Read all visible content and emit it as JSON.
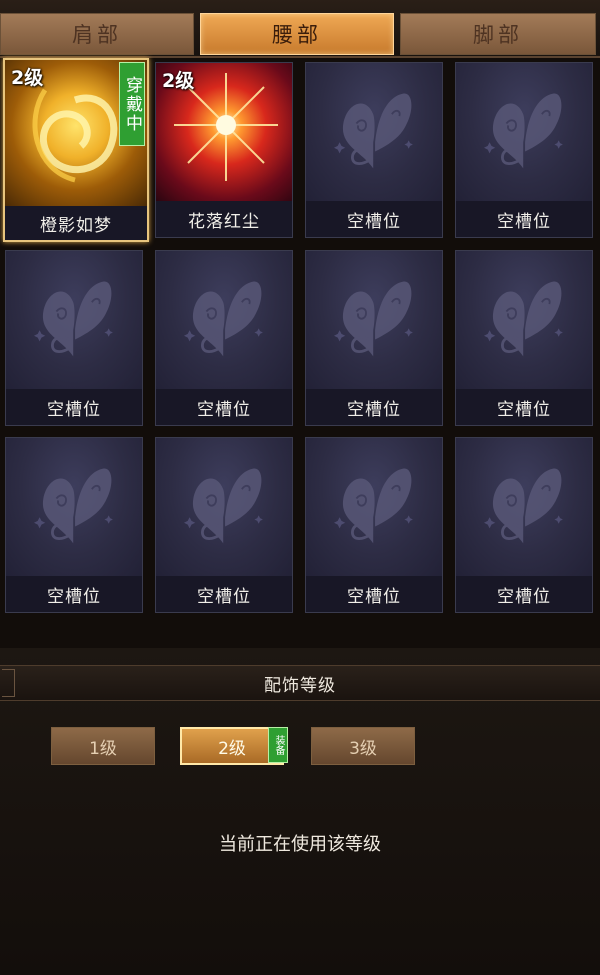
{
  "tabs": [
    {
      "label": "肩部",
      "active": false
    },
    {
      "label": "腰部",
      "active": true
    },
    {
      "label": "脚部",
      "active": false
    }
  ],
  "slots": [
    {
      "level": "2级",
      "name": "橙影如梦",
      "wearing": "穿戴中",
      "icon": "orange-swirl-icon"
    },
    {
      "level": "2级",
      "name": "花落红尘",
      "icon": "red-starburst-icon"
    },
    {
      "name": "空槽位",
      "icon": "butterfly-icon"
    },
    {
      "name": "空槽位",
      "icon": "butterfly-icon"
    },
    {
      "name": "空槽位",
      "icon": "butterfly-icon"
    },
    {
      "name": "空槽位",
      "icon": "butterfly-icon"
    },
    {
      "name": "空槽位",
      "icon": "butterfly-icon"
    },
    {
      "name": "空槽位",
      "icon": "butterfly-icon"
    },
    {
      "name": "空槽位",
      "icon": "butterfly-icon"
    },
    {
      "name": "空槽位",
      "icon": "butterfly-icon"
    },
    {
      "name": "空槽位",
      "icon": "butterfly-icon"
    },
    {
      "name": "空槽位",
      "icon": "butterfly-icon"
    }
  ],
  "level_section": {
    "title": "配饰等级",
    "levels": [
      "1级",
      "2级",
      "3级"
    ],
    "active_level": "2级",
    "equip_badge": "装备",
    "status": "当前正在使用该等级"
  },
  "colors": {
    "active_tab": "#e09a4a",
    "wearing_badge": "#2f9f32",
    "selected_border": "#e8c57e"
  }
}
